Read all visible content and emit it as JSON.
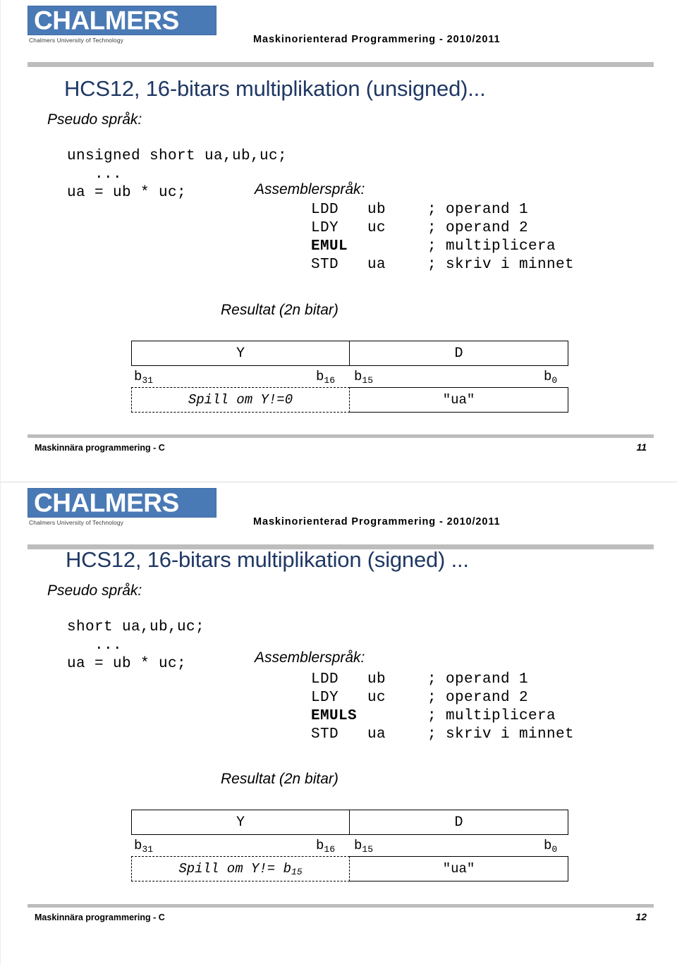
{
  "document": {
    "brand": {
      "logo_word": "CHALMERS",
      "logo_subtitle": "Chalmers University of Technology"
    }
  },
  "slides": [
    {
      "header_course": "Maskinorienterad Programmering - 2010/2011",
      "title": "HCS12, 16-bitars multiplikation (unsigned)...",
      "pseudo_label": "Pseudo språk:",
      "pseudo_code": [
        "unsigned short ua,ub,uc;",
        "   ...",
        "ua = ub * uc;"
      ],
      "asm_label": "Assemblerspråk:",
      "asm_lines": [
        {
          "mnemonic": "LDD",
          "operand": "ub",
          "comment": "; operand 1",
          "bold": false
        },
        {
          "mnemonic": "LDY",
          "operand": "uc",
          "comment": "; operand 2",
          "bold": false
        },
        {
          "mnemonic": "EMUL",
          "operand": "",
          "comment": "; multiplicera",
          "bold": true
        },
        {
          "mnemonic": "STD",
          "operand": "ua",
          "comment": "; skriv i minnet",
          "bold": false
        }
      ],
      "result_label": "Resultat (2n bitar)",
      "register_cells": {
        "high": "Y",
        "low": "D"
      },
      "bit_labels": {
        "b31": "b",
        "b31_sub": "31",
        "b16": "b",
        "b16_sub": "16",
        "b15": "b",
        "b15_sub": "15",
        "b0": "b",
        "b0_sub": "0"
      },
      "spill_text": "Spill om Y!=0",
      "spill_sub": "",
      "ua_text": "\"ua\"",
      "footer_text": "Maskinnära programmering - C",
      "footer_page": "11"
    },
    {
      "header_course": "Maskinorienterad Programmering - 2010/2011",
      "title": "HCS12, 16-bitars multiplikation (signed) ...",
      "pseudo_label": "Pseudo språk:",
      "pseudo_code": [
        "short ua,ub,uc;",
        "   ...",
        "ua = ub * uc;"
      ],
      "asm_label": "Assemblerspråk:",
      "asm_lines": [
        {
          "mnemonic": "LDD",
          "operand": "ub",
          "comment": "; operand 1",
          "bold": false
        },
        {
          "mnemonic": "LDY",
          "operand": "uc",
          "comment": "; operand 2",
          "bold": false
        },
        {
          "mnemonic": "EMULS",
          "operand": "",
          "comment": "; multiplicera",
          "bold": true
        },
        {
          "mnemonic": "STD",
          "operand": "ua",
          "comment": "; skriv i minnet",
          "bold": false
        }
      ],
      "result_label": "Resultat (2n bitar)",
      "register_cells": {
        "high": "Y",
        "low": "D"
      },
      "bit_labels": {
        "b31": "b",
        "b31_sub": "31",
        "b16": "b",
        "b16_sub": "16",
        "b15": "b",
        "b15_sub": "15",
        "b0": "b",
        "b0_sub": "0"
      },
      "spill_text": "Spill om Y!= b",
      "spill_sub": "15",
      "ua_text": "\"ua\"",
      "footer_text": "Maskinnära programmering - C",
      "footer_page": "12"
    }
  ],
  "colors": {
    "title_navy": "#1f3864",
    "logo_blue": "#4a7ab5",
    "rule_gray": "#bdbdbd"
  }
}
